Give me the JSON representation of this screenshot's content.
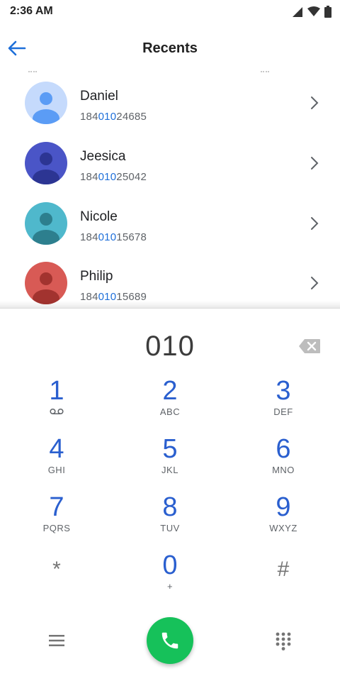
{
  "status_bar": {
    "time": "2:36 AM"
  },
  "header": {
    "title": "Recents"
  },
  "contacts": [
    {
      "name": "Daniel",
      "number_prefix": "184",
      "number_match": "010",
      "number_suffix": "24685",
      "avatar_bg": "#c5dafc",
      "avatar_fg": "#5b9cf5"
    },
    {
      "name": "Jeesica",
      "number_prefix": "184",
      "number_match": "010",
      "number_suffix": "25042",
      "avatar_bg": "#4a55c7",
      "avatar_fg": "#2c3593"
    },
    {
      "name": "Nicole",
      "number_prefix": "184",
      "number_match": "010",
      "number_suffix": "15678",
      "avatar_bg": "#4fb8cc",
      "avatar_fg": "#2d7f8e"
    },
    {
      "name": "Philip",
      "number_prefix": "184",
      "number_match": "010",
      "number_suffix": "15689",
      "avatar_bg": "#d85a55",
      "avatar_fg": "#a2332f"
    }
  ],
  "dialpad": {
    "entered_digits": "010",
    "keys": [
      {
        "digit": "1",
        "letters": ""
      },
      {
        "digit": "2",
        "letters": "ABC"
      },
      {
        "digit": "3",
        "letters": "DEF"
      },
      {
        "digit": "4",
        "letters": "GHI"
      },
      {
        "digit": "5",
        "letters": "JKL"
      },
      {
        "digit": "6",
        "letters": "MNO"
      },
      {
        "digit": "7",
        "letters": "PQRS"
      },
      {
        "digit": "8",
        "letters": "TUV"
      },
      {
        "digit": "9",
        "letters": "WXYZ"
      },
      {
        "digit": "*",
        "letters": ""
      },
      {
        "digit": "0",
        "letters": "+"
      },
      {
        "digit": "#",
        "letters": ""
      }
    ]
  },
  "colors": {
    "accent": "#1e6fd9",
    "digit_blue": "#2a5fcf",
    "call_green": "#16c15a"
  },
  "icons": {
    "back": "arrow-left-icon",
    "backspace": "backspace-icon",
    "voicemail": "voicemail-icon",
    "call": "phone-icon",
    "menu": "menu-icon",
    "dialpad": "dialpad-icon",
    "chevron": "chevron-right-icon"
  }
}
